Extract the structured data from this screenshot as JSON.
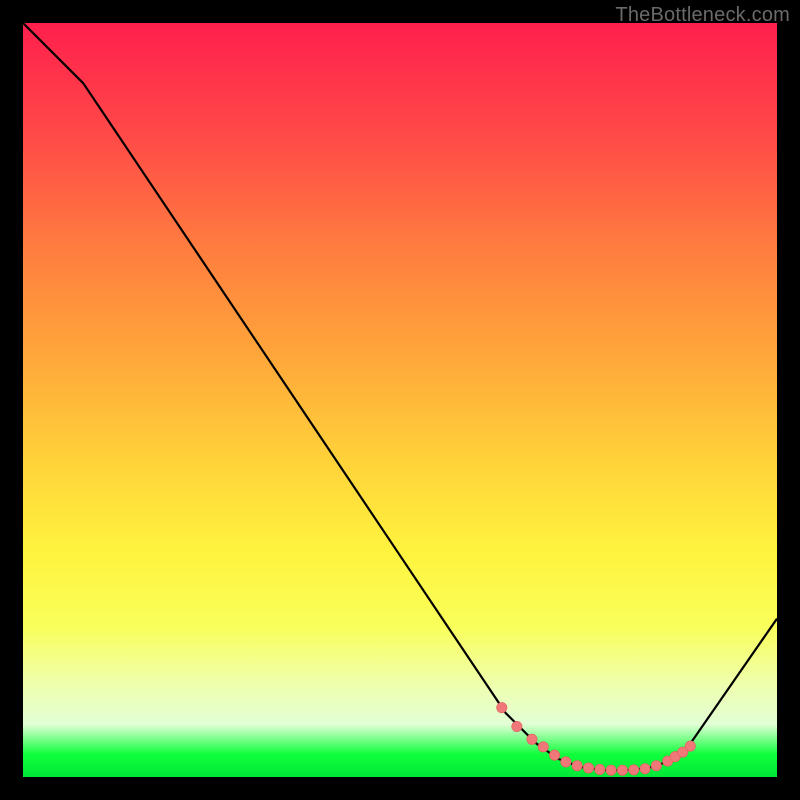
{
  "watermark": "TheBottleneck.com",
  "colors": {
    "page_bg": "#000000",
    "line": "#000000",
    "dot_fill": "#f07878",
    "dot_stroke": "#e06060"
  },
  "chart_data": {
    "type": "line",
    "title": "",
    "xlabel": "",
    "ylabel": "",
    "xlim": [
      0,
      100
    ],
    "ylim": [
      0,
      100
    ],
    "grid": false,
    "legend": false,
    "annotations": [],
    "series": [
      {
        "name": "curve",
        "x": [
          0,
          8,
          64,
          68,
          71,
          74,
          77,
          80,
          83,
          86,
          88,
          100
        ],
        "y": [
          100,
          92,
          8.5,
          4.5,
          2.4,
          1.3,
          0.9,
          0.9,
          1.2,
          2.2,
          3.7,
          21
        ]
      }
    ],
    "highlight_dots": {
      "name": "highlight",
      "x": [
        63.5,
        65.5,
        67.5,
        69,
        70.5,
        72,
        73.5,
        75,
        76.5,
        78,
        79.5,
        81,
        82.5,
        84,
        85.5,
        86.5,
        87.5,
        88.5
      ],
      "y": [
        9.2,
        6.7,
        5.0,
        4.0,
        2.9,
        2.0,
        1.5,
        1.2,
        1.0,
        0.9,
        0.9,
        0.95,
        1.1,
        1.5,
        2.1,
        2.7,
        3.3,
        4.1
      ]
    }
  }
}
